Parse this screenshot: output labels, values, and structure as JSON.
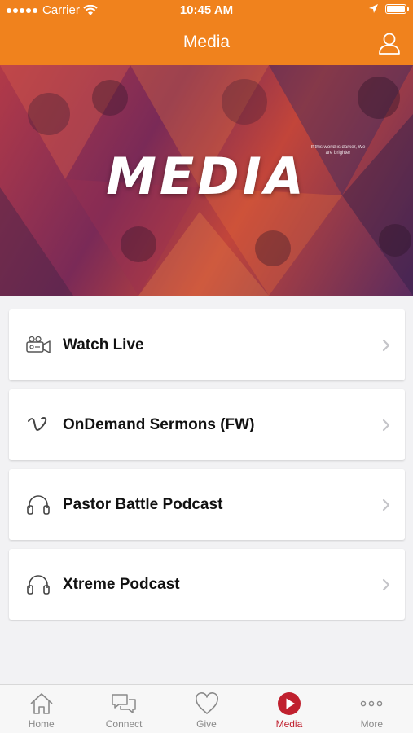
{
  "status_bar": {
    "carrier": "Carrier",
    "time": "10:45 AM"
  },
  "nav": {
    "title": "Media",
    "profile_icon": "person-icon"
  },
  "hero": {
    "title": "MEDIA",
    "small_text": "If this world is darker, We are brighter"
  },
  "menu": [
    {
      "label": "Watch Live",
      "icon": "video-camera-icon"
    },
    {
      "label": "OnDemand Sermons (FW)",
      "icon": "vimeo-icon"
    },
    {
      "label": "Pastor Battle Podcast",
      "icon": "headphones-icon"
    },
    {
      "label": "Xtreme Podcast",
      "icon": "headphones-icon"
    }
  ],
  "tabs": [
    {
      "label": "Home",
      "icon": "home-icon",
      "active": false
    },
    {
      "label": "Connect",
      "icon": "chat-bubbles-icon",
      "active": false
    },
    {
      "label": "Give",
      "icon": "heart-icon",
      "active": false
    },
    {
      "label": "Media",
      "icon": "play-icon",
      "active": true
    },
    {
      "label": "More",
      "icon": "more-dots-icon",
      "active": false
    }
  ],
  "colors": {
    "brand": "#f0821d",
    "active_tab": "#c0202e",
    "background": "#f2f2f4"
  }
}
